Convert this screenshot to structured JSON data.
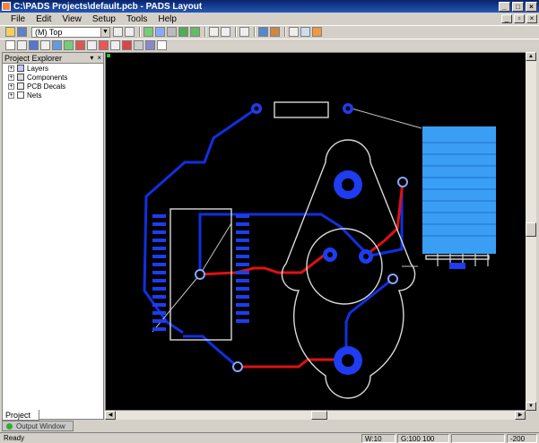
{
  "window": {
    "title": "C:\\PADS Projects\\default.pcb - PADS Layout"
  },
  "menu": {
    "items": [
      "File",
      "Edit",
      "View",
      "Setup",
      "Tools",
      "Help"
    ]
  },
  "toolbar": {
    "layer_value": "(M) Top"
  },
  "explorer": {
    "title": "Project Explorer",
    "pin": "📌",
    "close": "×",
    "items": [
      "Layers",
      "Components",
      "PCB Decals",
      "Nets"
    ],
    "tab_label": "Project"
  },
  "output_window": {
    "label": "Output Window"
  },
  "status": {
    "text": "Ready",
    "width": "W:10",
    "grid": "G:100 100",
    "coord": "-200"
  },
  "colors": {
    "board": "#000000",
    "trace_blue": "#1030e0",
    "trace_red": "#e01010",
    "outline": "#d8d8d8",
    "pad_blue": "#1e3cf0",
    "smt_fill": "#3a9ef5"
  }
}
